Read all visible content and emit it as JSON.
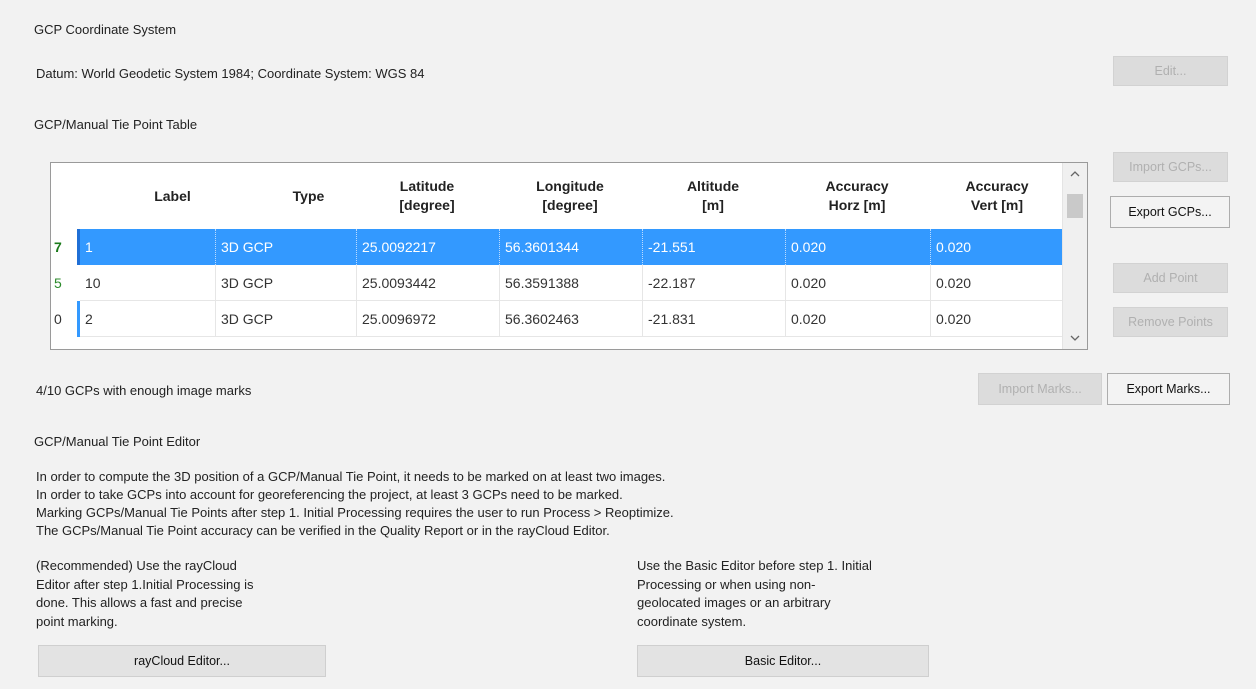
{
  "coord_system": {
    "heading": "GCP Coordinate System",
    "datum_text": "Datum: World Geodetic System 1984; Coordinate System: WGS 84",
    "edit_button": "Edit..."
  },
  "table_section": {
    "heading": "GCP/Manual Tie Point Table",
    "columns": [
      {
        "line1": "Label",
        "line2": ""
      },
      {
        "line1": "Type",
        "line2": ""
      },
      {
        "line1": "Latitude",
        "line2": "[degree]"
      },
      {
        "line1": "Longitude",
        "line2": "[degree]"
      },
      {
        "line1": "Altitude",
        "line2": "[m]"
      },
      {
        "line1": "Accuracy",
        "line2": "Horz [m]"
      },
      {
        "line1": "Accuracy",
        "line2": "Vert [m]"
      }
    ],
    "rows": [
      {
        "index": "7",
        "label": "1",
        "type": "3D GCP",
        "latitude": "25.0092217",
        "longitude": "56.3601344",
        "altitude": "-21.551",
        "acc_horz": "0.020",
        "acc_vert": "0.020",
        "selected": true
      },
      {
        "index": "5",
        "label": "10",
        "type": "3D GCP",
        "latitude": "25.0093442",
        "longitude": "56.3591388",
        "altitude": "-22.187",
        "acc_horz": "0.020",
        "acc_vert": "0.020",
        "selected": false
      },
      {
        "index": "0",
        "label": "2",
        "type": "3D GCP",
        "latitude": "25.0096972",
        "longitude": "56.3602463",
        "altitude": "-21.831",
        "acc_horz": "0.020",
        "acc_vert": "0.020",
        "selected": false
      }
    ],
    "buttons": {
      "import": "Import GCPs...",
      "export": "Export GCPs...",
      "add": "Add Point",
      "remove": "Remove Points"
    }
  },
  "marks": {
    "status": "4/10 GCPs with enough image marks",
    "import_button": "Import Marks...",
    "export_button": "Export Marks..."
  },
  "editor": {
    "heading": "GCP/Manual Tie Point Editor",
    "info_lines": [
      "In order to compute the 3D position of a GCP/Manual Tie Point, it needs to be marked on at least two images.",
      "In order to take GCPs into account for georeferencing the project, at least 3 GCPs need to be marked.",
      "Marking GCPs/Manual Tie Points after step 1. Initial Processing requires the user to run Process > Reoptimize.",
      "The GCPs/Manual Tie Point accuracy can be verified in the Quality Report or in the rayCloud Editor."
    ],
    "raycloud_text_lines": [
      "(Recommended) Use the rayCloud",
      "Editor after step 1.Initial Processing is",
      "done. This allows a fast and precise",
      "point marking."
    ],
    "basic_text_lines": [
      "Use the Basic Editor before step 1. Initial",
      "Processing or when using non-",
      "geolocated images or an arbitrary",
      "coordinate system."
    ],
    "raycloud_button": "rayCloud Editor...",
    "basic_button": "Basic Editor..."
  },
  "icons": {
    "scroll_up": "chevron-up-icon",
    "scroll_down": "chevron-down-icon"
  }
}
